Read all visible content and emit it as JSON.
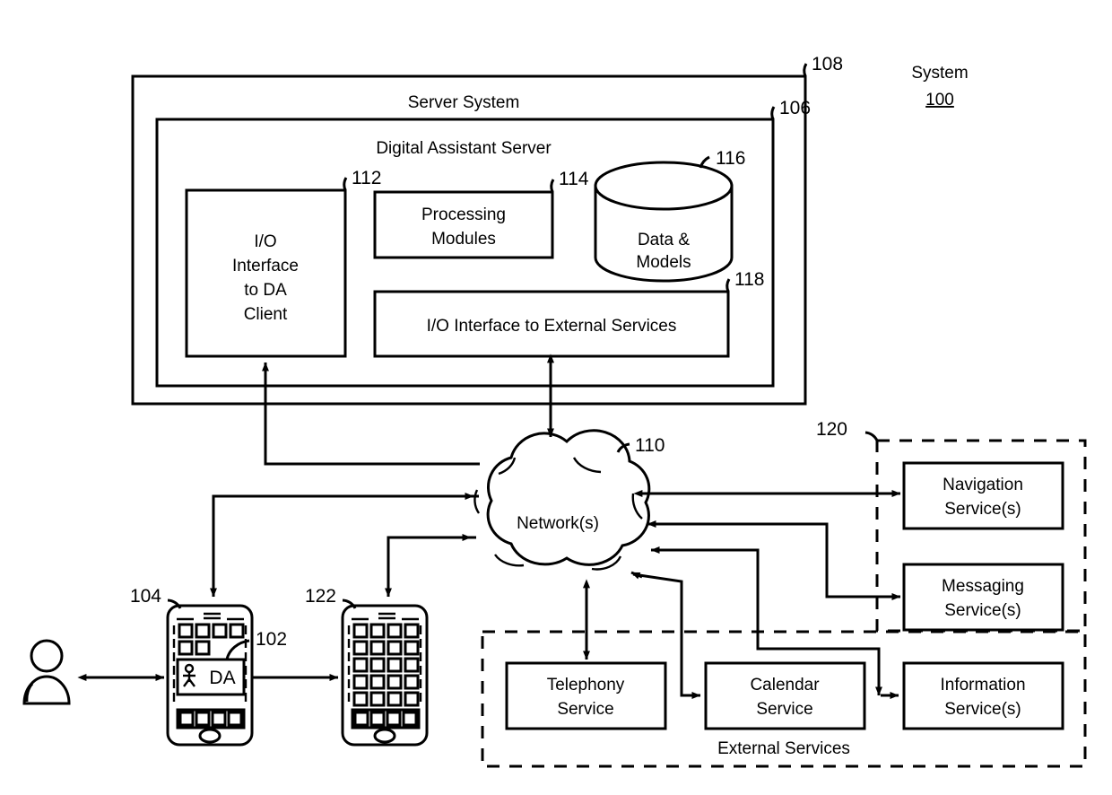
{
  "figure": {
    "system_label_line1": "System",
    "system_label_line2": "100"
  },
  "containers": {
    "server_system": {
      "title": "Server System",
      "ref": "108"
    },
    "digital_assistant_server": {
      "title": "Digital Assistant Server",
      "ref": "106"
    },
    "external_services_right": {
      "ref": "120"
    },
    "external_services_bottom": {
      "title": "External Services"
    }
  },
  "server_blocks": [
    {
      "name": "io-interface-da-client",
      "lines": [
        "I/O",
        "Interface",
        "to DA",
        "Client"
      ],
      "ref": "112"
    },
    {
      "name": "processing-modules",
      "lines": [
        "Processing",
        "Modules"
      ],
      "ref": "114"
    },
    {
      "name": "data-and-models",
      "lines": [
        "Data &",
        "Models"
      ],
      "ref": "116"
    },
    {
      "name": "io-interface-external-services",
      "lines": [
        "I/O Interface to External Services"
      ],
      "ref": "118"
    }
  ],
  "network": {
    "label": "Network(s)",
    "ref": "110"
  },
  "devices": [
    {
      "name": "user-device-primary",
      "ref": "104",
      "widget_label": "DA",
      "widget_ref": "102"
    },
    {
      "name": "user-device-secondary",
      "ref": "122"
    }
  ],
  "user": {
    "name": "user-figure"
  },
  "services_right": [
    {
      "name": "navigation-service",
      "lines": [
        "Navigation",
        "Service(s)"
      ]
    },
    {
      "name": "messaging-service",
      "lines": [
        "Messaging",
        "Service(s)"
      ]
    },
    {
      "name": "information-service",
      "lines": [
        "Information",
        "Service(s)"
      ]
    }
  ],
  "services_bottom": [
    {
      "name": "telephony-service",
      "lines": [
        "Telephony",
        "Service"
      ]
    },
    {
      "name": "calendar-service",
      "lines": [
        "Calendar",
        "Service"
      ]
    }
  ],
  "colors": {
    "line": "#000000",
    "background": "#ffffff"
  }
}
